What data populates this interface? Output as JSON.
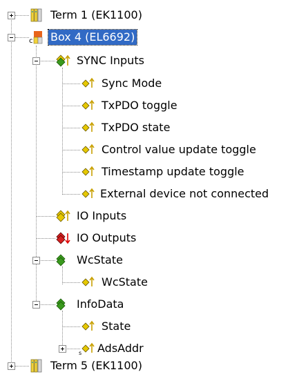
{
  "tree": {
    "nodes": [
      {
        "label": "Term 1 (EK1100)",
        "icon": "terminal-coupler-icon",
        "expander": "plus"
      },
      {
        "label": "Box 4 (EL6692)",
        "icon": "ethercat-bridge-box-icon",
        "expander": "minus",
        "selected": true
      },
      {
        "label": "SYNC Inputs",
        "icon": "input-group-icon",
        "expander": "minus"
      },
      {
        "label": "Sync Mode",
        "icon": "input-variable-icon"
      },
      {
        "label": "TxPDO toggle",
        "icon": "input-variable-icon"
      },
      {
        "label": "TxPDO state",
        "icon": "input-variable-icon"
      },
      {
        "label": "Control value update toggle",
        "icon": "input-variable-icon"
      },
      {
        "label": "Timestamp update toggle",
        "icon": "input-variable-icon"
      },
      {
        "label": "External device not connected",
        "icon": "input-variable-icon"
      },
      {
        "label": "IO Inputs",
        "icon": "input-group-icon"
      },
      {
        "label": "IO Outputs",
        "icon": "output-group-icon"
      },
      {
        "label": "WcState",
        "icon": "status-group-icon",
        "expander": "minus"
      },
      {
        "label": "WcState",
        "icon": "input-variable-icon"
      },
      {
        "label": "InfoData",
        "icon": "status-group-icon",
        "expander": "minus"
      },
      {
        "label": "State",
        "icon": "input-variable-icon"
      },
      {
        "label": "AdsAddr",
        "icon": "input-variable-icon",
        "expander": "plus"
      },
      {
        "label": "Term 5 (EK1100)",
        "icon": "terminal-coupler-icon",
        "expander": "plus"
      }
    ]
  },
  "colors": {
    "selection": "#316ac5",
    "input_arrow": "#c8a000",
    "output_arrow": "#e00000",
    "group_green": "#3a9a1e",
    "group_yellow": "#e6c800"
  }
}
